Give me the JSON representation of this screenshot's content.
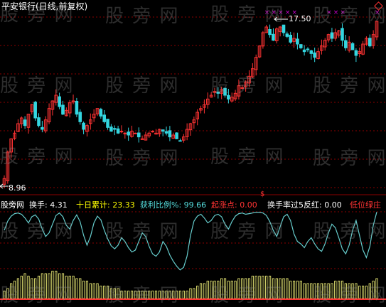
{
  "header": {
    "title": "平安银行(日线,前复权)",
    "title_color": "#ffffff"
  },
  "annotations": {
    "high_label": "17.50",
    "low_label": "8.96"
  },
  "watermark": "股 旁 网",
  "indicator_bar": {
    "source": "股旁网",
    "items": [
      {
        "label": "换手: 4.31",
        "color": "#ffffff"
      },
      {
        "label": "十日累计: 23.33",
        "color": "#ffff00"
      },
      {
        "label": "获利比例%: 99.66",
        "color": "#55dddd"
      },
      {
        "label": "起涨点: 0.00",
        "color": "#ff3333"
      },
      {
        "label": "换手率过5反红: 0.00",
        "color": "#ffffff"
      },
      {
        "label": "低位绿庄",
        "color": "#ff3333"
      }
    ]
  },
  "colors": {
    "up": "#ff3333",
    "down": "#33d6e0",
    "grid": "#8b0000",
    "marker": "#cc00cc",
    "profit_line": "#66cccc",
    "volume": "#ffff80",
    "volume_red": "#ff3333"
  },
  "chart_data": {
    "type": "candlestick",
    "title": "平安银行(日线,前复权)",
    "price_high": 17.5,
    "price_low": 8.96,
    "close": [
      9.2,
      10.6,
      11.3,
      11.6,
      12.1,
      12.4,
      12.0,
      12.6,
      13.1,
      12.4,
      12.0,
      11.8,
      12.3,
      12.9,
      13.3,
      13.6,
      13.0,
      12.6,
      12.8,
      13.2,
      13.3,
      12.6,
      12.2,
      11.8,
      12.0,
      12.3,
      12.6,
      12.9,
      12.5,
      12.2,
      11.9,
      11.7,
      11.8,
      11.6,
      11.7,
      11.6,
      11.5,
      11.7,
      11.6,
      11.4,
      11.3,
      11.5,
      11.6,
      11.7,
      11.6,
      11.8,
      11.7,
      11.6,
      11.4,
      11.5,
      11.3,
      11.2,
      11.4,
      11.8,
      12.1,
      12.3,
      12.7,
      12.9,
      13.1,
      13.4,
      13.6,
      13.8,
      13.7,
      13.9,
      13.6,
      13.4,
      13.5,
      13.7,
      14.1,
      14.0,
      14.3,
      14.6,
      15.0,
      15.6,
      16.2,
      16.9,
      17.2,
      16.8,
      16.5,
      17.1,
      17.2,
      16.9,
      16.7,
      16.4,
      16.6,
      16.3,
      16.1,
      15.9,
      16.0,
      15.8,
      15.6,
      15.9,
      16.2,
      16.5,
      16.8,
      16.6,
      16.9,
      17.0,
      16.5,
      16.1,
      16.4,
      16.0,
      15.7,
      15.9,
      16.3,
      16.6,
      16.2,
      16.8,
      17.5
    ],
    "profit_ratio_pct": [
      70,
      85,
      93,
      97,
      98,
      96,
      90,
      82,
      92,
      95,
      88,
      72,
      60,
      66,
      80,
      94,
      98,
      92,
      78,
      72,
      86,
      95,
      84,
      62,
      46,
      60,
      82,
      93,
      87,
      70,
      56,
      45,
      40,
      46,
      58,
      52,
      42,
      35,
      38,
      52,
      66,
      60,
      44,
      32,
      28,
      35,
      52,
      44,
      30,
      20,
      12,
      6,
      10,
      28,
      62,
      85,
      93,
      96,
      90,
      82,
      86,
      94,
      96,
      92,
      80,
      72,
      84,
      93,
      97,
      98,
      96,
      97,
      98,
      99,
      99,
      98,
      94,
      84,
      70,
      60,
      76,
      92,
      96,
      86,
      64,
      52,
      48,
      42,
      52,
      58,
      48,
      40,
      36,
      48,
      66,
      80,
      74,
      58,
      40,
      32,
      46,
      70,
      86,
      62,
      38,
      26,
      44,
      78,
      99.66
    ],
    "turnover": [
      3,
      4,
      6,
      7,
      8,
      9,
      10,
      9,
      8,
      8,
      9,
      10,
      10,
      10,
      11,
      11,
      10,
      10,
      9,
      9,
      9,
      8,
      8,
      7,
      7,
      6,
      6,
      6,
      5,
      5,
      5,
      4,
      4,
      4,
      3,
      3,
      3,
      3,
      3,
      3,
      3,
      3,
      3,
      3,
      3,
      3,
      3,
      3,
      3,
      3,
      3,
      3,
      3,
      3,
      4,
      4,
      5,
      6,
      6,
      7,
      7,
      7,
      7,
      8,
      8,
      7,
      7,
      7,
      8,
      8,
      8,
      8,
      9,
      9,
      9,
      9,
      9,
      9,
      8,
      8,
      8,
      8,
      8,
      7,
      7,
      7,
      7,
      6,
      6,
      6,
      6,
      6,
      6,
      6,
      6,
      6,
      7,
      7,
      7,
      6,
      6,
      6,
      6,
      5,
      5,
      5,
      6,
      7,
      8
    ],
    "turnover_current": 4.31,
    "ten_day_turnover": 23.33,
    "profit_ratio_current": 99.66,
    "rise_point": 0.0,
    "turnover_over5_red": 0.0
  }
}
